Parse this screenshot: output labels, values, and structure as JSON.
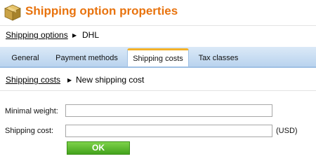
{
  "header": {
    "title": "Shipping option properties",
    "icon": "box-icon"
  },
  "breadcrumb_top": {
    "link": "Shipping options",
    "current": "DHL"
  },
  "tabs": [
    {
      "label": "General"
    },
    {
      "label": "Payment methods"
    },
    {
      "label": "Shipping costs",
      "active": true
    },
    {
      "label": "Tax classes"
    }
  ],
  "breadcrumb_section": {
    "link": "Shipping costs",
    "current": "New shipping cost"
  },
  "form": {
    "min_weight": {
      "label": "Minimal weight:",
      "value": ""
    },
    "shipping_cost": {
      "label": "Shipping cost:",
      "value": "",
      "unit": "(USD)"
    },
    "ok_label": "OK"
  },
  "colors": {
    "title": "#e8730e",
    "tab_bar": "#c9def3",
    "active_tab_accent": "#f3b12a",
    "ok_button": "#5cb82f"
  }
}
